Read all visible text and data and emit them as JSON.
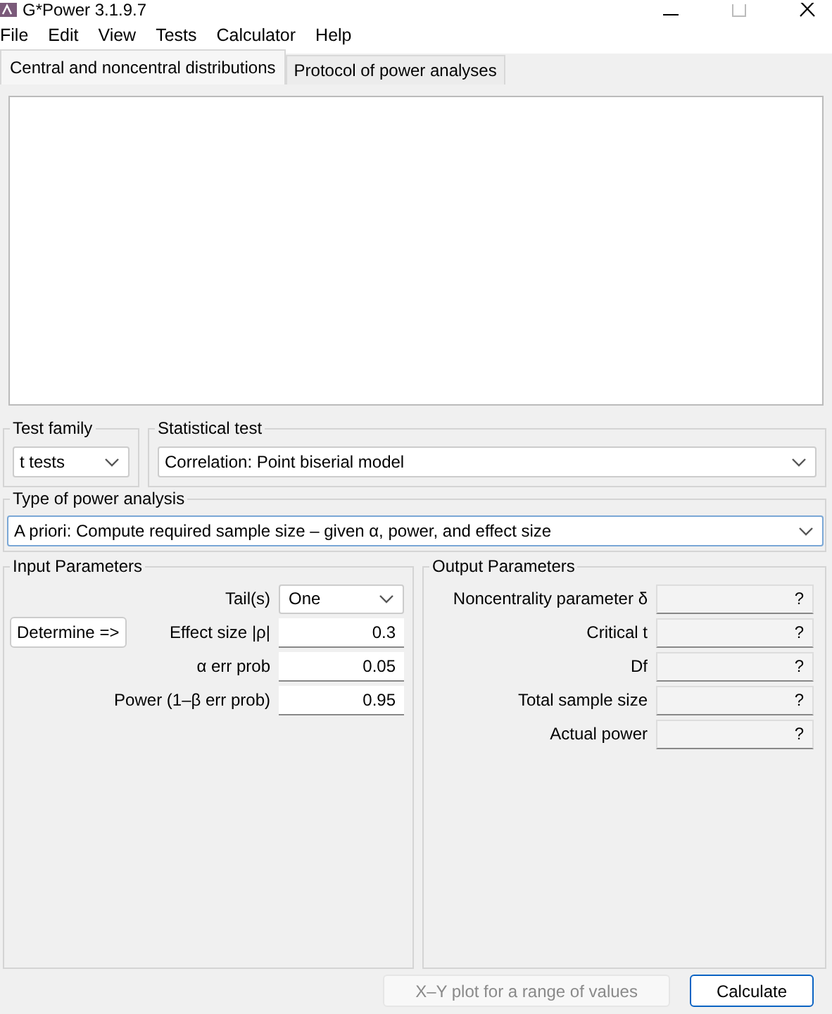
{
  "window": {
    "title": "G*Power 3.1.9.7"
  },
  "menu": [
    "File",
    "Edit",
    "View",
    "Tests",
    "Calculator",
    "Help"
  ],
  "tabs": [
    {
      "label": "Central and noncentral distributions",
      "selected": true
    },
    {
      "label": "Protocol of power analyses",
      "selected": false
    }
  ],
  "test_family": {
    "label": "Test family",
    "value": "t tests"
  },
  "statistical_test": {
    "label": "Statistical test",
    "value": "Correlation: Point biserial model"
  },
  "power_analysis_type": {
    "label": "Type of power analysis",
    "value": "A priori: Compute required sample size – given α, power, and effect size"
  },
  "input_parameters": {
    "title": "Input Parameters",
    "determine_button": "Determine =>",
    "fields": [
      {
        "label": "Tail(s)",
        "value": "One",
        "kind": "dropdown"
      },
      {
        "label": "Effect size |ρ|",
        "value": "0.3",
        "kind": "input"
      },
      {
        "label": "α err prob",
        "value": "0.05",
        "kind": "input"
      },
      {
        "label": "Power (1–β err prob)",
        "value": "0.95",
        "kind": "input"
      }
    ]
  },
  "output_parameters": {
    "title": "Output Parameters",
    "fields": [
      {
        "label": "Noncentrality parameter δ",
        "value": "?"
      },
      {
        "label": "Critical t",
        "value": "?"
      },
      {
        "label": "Df",
        "value": "?"
      },
      {
        "label": "Total sample size",
        "value": "?"
      },
      {
        "label": "Actual power",
        "value": "?"
      }
    ]
  },
  "buttons": [
    {
      "label": "X–Y plot for a range of values",
      "disabled": true
    },
    {
      "label": "Calculate",
      "disabled": false
    }
  ]
}
